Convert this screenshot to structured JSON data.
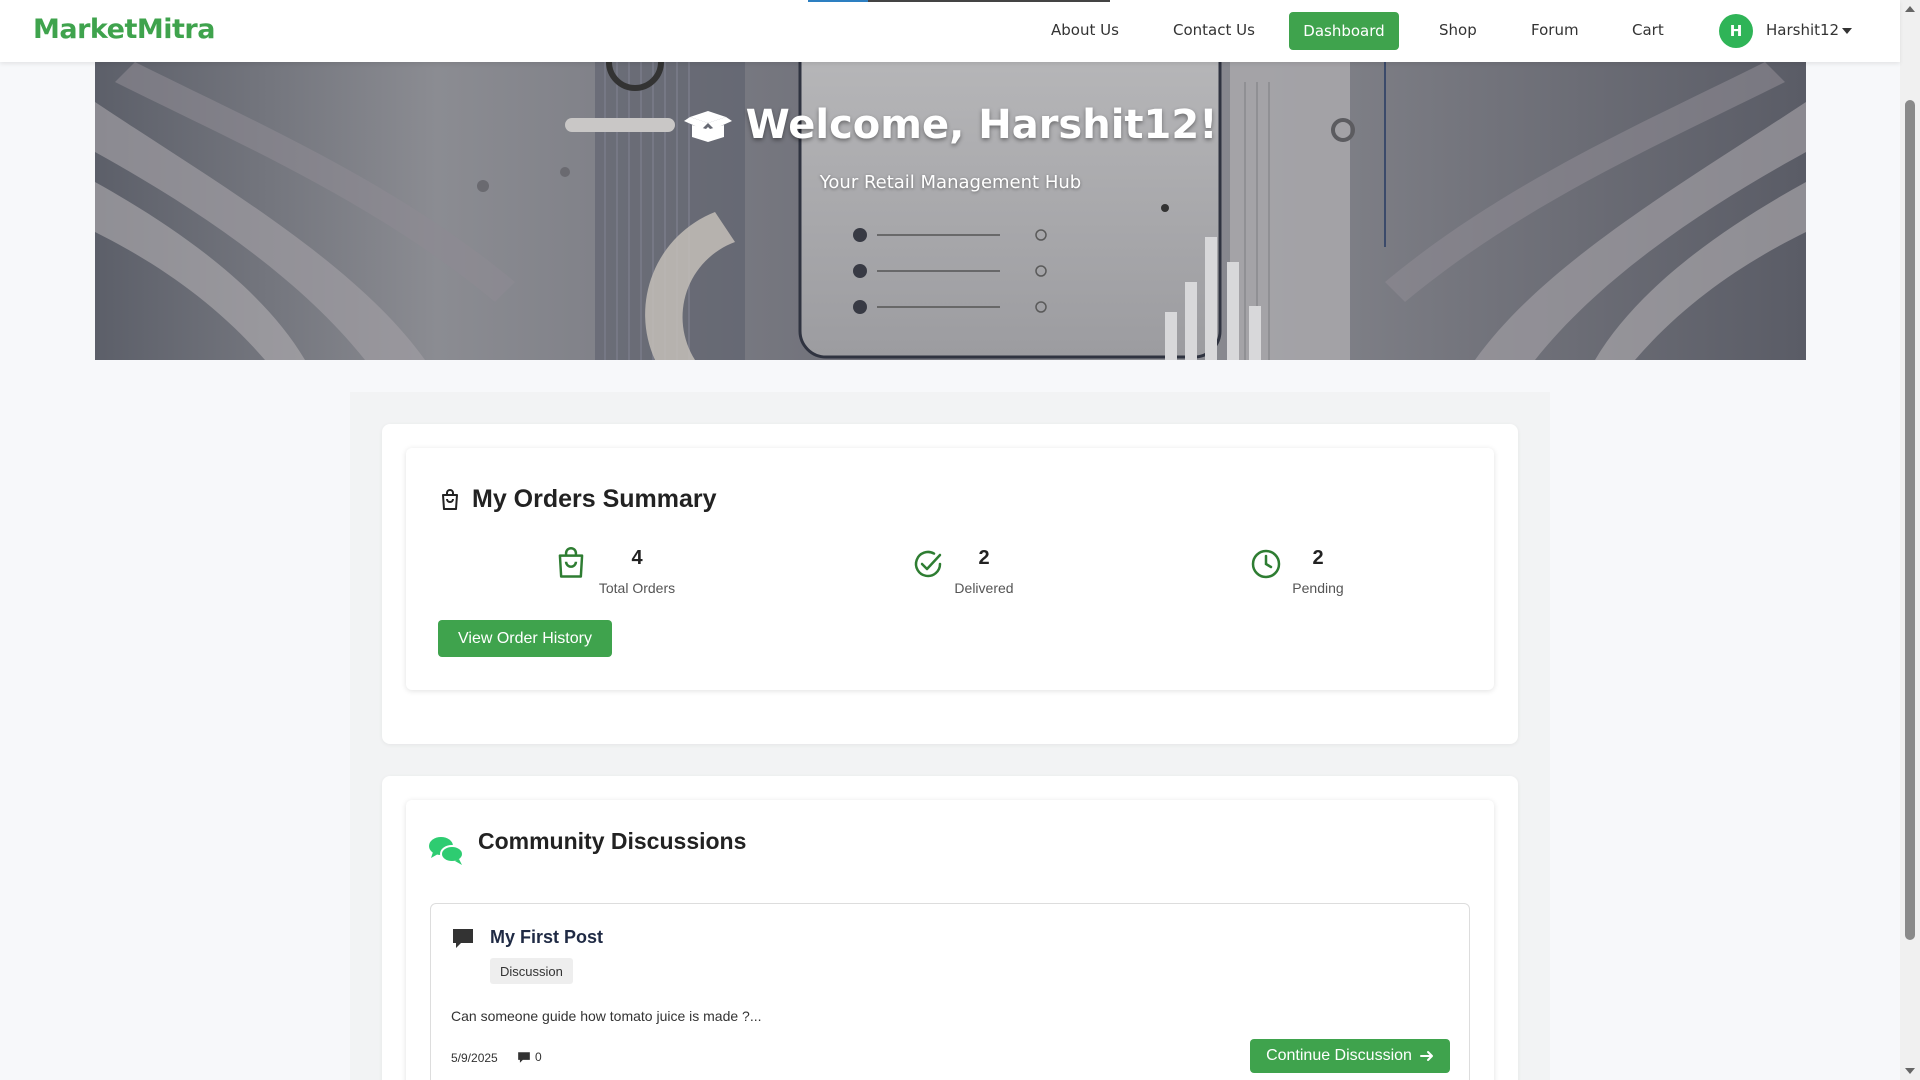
{
  "nav": {
    "brand": "MarketMitra",
    "links": [
      "About Us",
      "Contact Us",
      "Dashboard",
      "Shop",
      "Forum",
      "Cart"
    ],
    "active": "Dashboard",
    "user_initial": "H",
    "user_name": "Harshit12"
  },
  "hero": {
    "title": "Welcome, Harshit12!",
    "subtitle": "Your Retail Management Hub",
    "icon": "box-open-icon"
  },
  "orders": {
    "title": "My Orders Summary",
    "stats": [
      {
        "value": "4",
        "label": "Total Orders",
        "icon": "shopping-bag-icon"
      },
      {
        "value": "2",
        "label": "Delivered",
        "icon": "check-circle-icon"
      },
      {
        "value": "2",
        "label": "Pending",
        "icon": "clock-icon"
      }
    ],
    "button": "View Order History"
  },
  "community": {
    "title": "Community Discussions",
    "posts": [
      {
        "title": "My First Post",
        "tag": "Discussion",
        "excerpt": "Can someone guide how tomato juice is made ?...",
        "date": "5/9/2025",
        "comments": "0",
        "button": "Continue Discussion"
      }
    ]
  },
  "colors": {
    "brand_green": "#3fa34d",
    "avatar_green": "#2fb457",
    "icon_dark_green": "#2e7d32",
    "chat_icon_green": "#2ecc71"
  }
}
